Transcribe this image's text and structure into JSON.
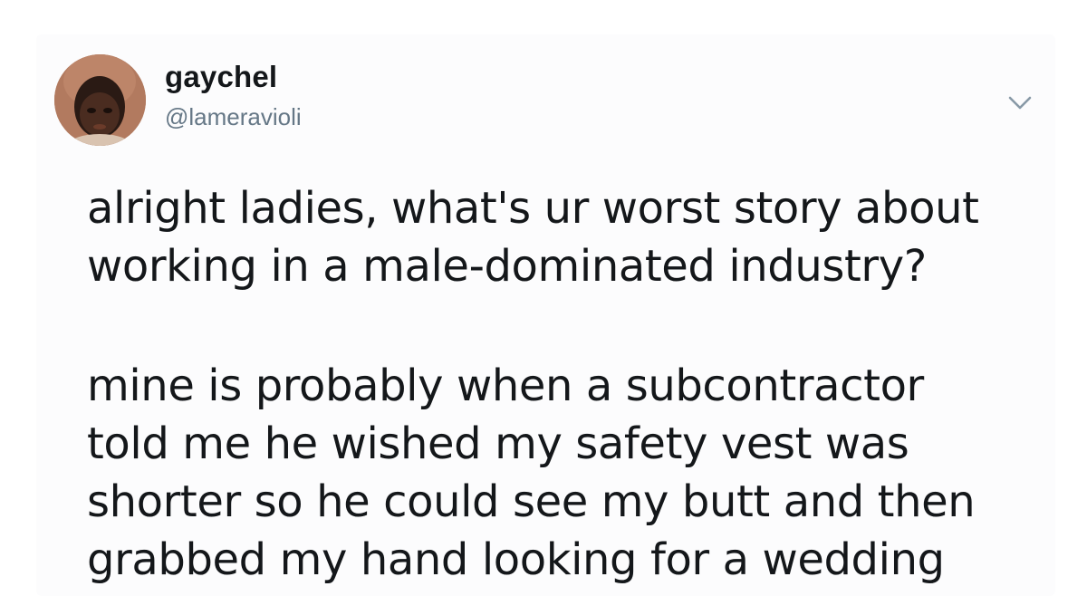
{
  "user": {
    "display_name": "gaychel",
    "handle": "@lameravioli",
    "avatar_icon": "avatar-photo"
  },
  "menu": {
    "icon": "chevron-down-icon"
  },
  "tweet": {
    "paragraph_1": [
      "alright ladies, what's ur worst story about",
      "working in a male-dominated industry?"
    ],
    "paragraph_2": [
      "mine is probably when a subcontractor",
      "told me he wished my safety vest was",
      "shorter so he could see my butt and then",
      "grabbed my hand looking for a wedding"
    ]
  },
  "colors": {
    "text": "#14171a",
    "secondary_text": "#657786",
    "caret": "#8899a6"
  }
}
